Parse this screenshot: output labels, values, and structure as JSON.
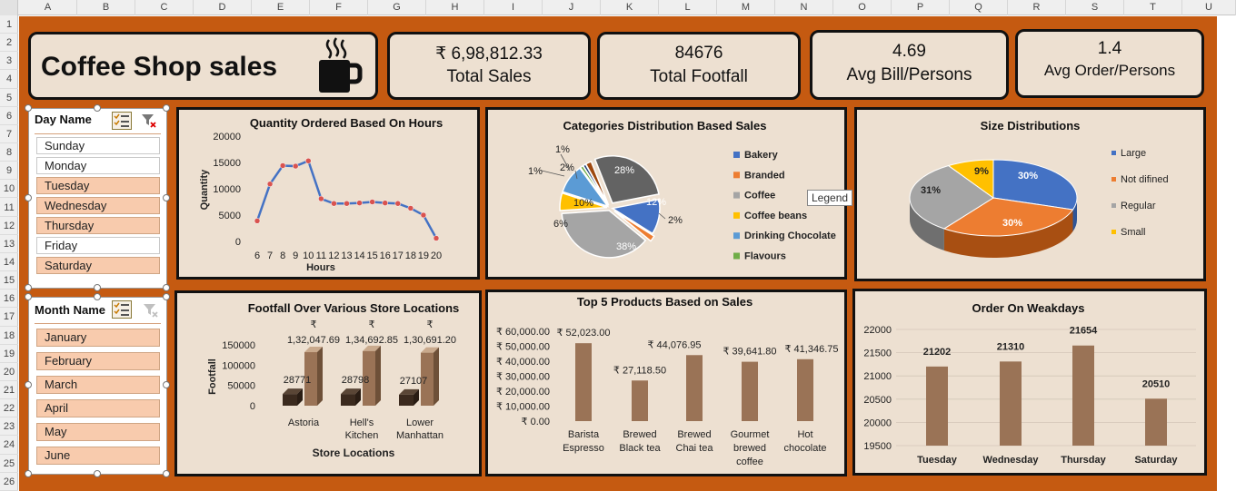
{
  "columns": [
    "A",
    "B",
    "C",
    "D",
    "E",
    "F",
    "G",
    "H",
    "I",
    "J",
    "K",
    "L",
    "M",
    "N",
    "O",
    "P",
    "Q",
    "R",
    "S",
    "T",
    "U"
  ],
  "rows": [
    "1",
    "2",
    "3",
    "4",
    "5",
    "6",
    "7",
    "8",
    "9",
    "10",
    "11",
    "12",
    "13",
    "14",
    "15",
    "16",
    "17",
    "18",
    "19",
    "20",
    "21",
    "22",
    "23",
    "24",
    "25",
    "26"
  ],
  "title": "Coffee Shop sales",
  "icons": {
    "cup": "coffee-cup-icon",
    "multiselect": "multi-select-icon",
    "clear_filter": "clear-filter-icon"
  },
  "colors": {
    "background": "#c55a11",
    "card": "#ede0d1",
    "selected": "#f8cbad",
    "bar_brown": "#9a7356",
    "line_blue": "#4472c4"
  },
  "kpis": [
    {
      "value": "₹ 6,98,812.33",
      "label": "Total Sales"
    },
    {
      "value": "84676",
      "label": "Total Footfall"
    },
    {
      "value": "4.69",
      "label": "Avg Bill/Persons"
    },
    {
      "value": "1.4",
      "label": "Avg Order/Persons"
    }
  ],
  "day_slicer": {
    "header": "Day Name",
    "items": [
      {
        "label": "Sunday",
        "selected": false
      },
      {
        "label": "Monday",
        "selected": false
      },
      {
        "label": "Tuesday",
        "selected": true
      },
      {
        "label": "Wednesday",
        "selected": true
      },
      {
        "label": "Thursday",
        "selected": true
      },
      {
        "label": "Friday",
        "selected": false
      },
      {
        "label": "Saturday",
        "selected": true
      }
    ]
  },
  "month_slicer": {
    "header": "Month Name",
    "items": [
      {
        "label": "January",
        "selected": true
      },
      {
        "label": "February",
        "selected": true
      },
      {
        "label": "March",
        "selected": true
      },
      {
        "label": "April",
        "selected": true
      },
      {
        "label": "May",
        "selected": true
      },
      {
        "label": "June",
        "selected": true
      }
    ]
  },
  "tooltip": "Legend",
  "chart_data": [
    {
      "type": "line",
      "title": "Quantity Ordered Based On Hours",
      "xlabel": "Hours",
      "ylabel": "Quantity",
      "x": [
        6,
        7,
        8,
        9,
        10,
        11,
        12,
        13,
        14,
        15,
        16,
        17,
        18,
        19,
        20
      ],
      "values": [
        3900,
        10900,
        14400,
        14300,
        15300,
        8100,
        7200,
        7200,
        7300,
        7500,
        7300,
        7200,
        6300,
        5000,
        600
      ],
      "ylim": [
        0,
        20000
      ],
      "yticks": [
        "20000",
        "15000",
        "10000",
        "5000",
        "0"
      ],
      "xticks": [
        "6",
        "7",
        "8",
        "9",
        "10",
        "11",
        "12",
        "13",
        "14",
        "15",
        "16",
        "17",
        "18",
        "19",
        "20"
      ]
    },
    {
      "type": "pie",
      "title": "Categories Distribution Based Sales",
      "legend_position": "right",
      "series": [
        {
          "name": "Bakery",
          "value": 12,
          "label": "12%",
          "color": "#4472c4"
        },
        {
          "name": "Branded",
          "value": 2,
          "label": "2%",
          "color": "#ed7d31"
        },
        {
          "name": "Coffee",
          "value": 38,
          "label": "38%",
          "color": "#a5a5a5"
        },
        {
          "name": "Coffee beans",
          "value": 6,
          "label": "6%",
          "color": "#ffc000"
        },
        {
          "name": "Drinking Chocolate",
          "value": 10,
          "label": "10%",
          "color": "#5b9bd5"
        },
        {
          "name": "Flavours",
          "value": 1,
          "label": "1%",
          "color": "#70ad47"
        },
        {
          "name": "",
          "value": 1,
          "label": "1%",
          "color": "#264478"
        },
        {
          "name": "",
          "value": 2,
          "label": "2%",
          "color": "#9e480e"
        },
        {
          "name": "",
          "value": 28,
          "label": "28%",
          "color": "#636363"
        }
      ]
    },
    {
      "type": "pie",
      "title": "Size Distributions",
      "legend_position": "right",
      "series": [
        {
          "name": "Large",
          "value": 30,
          "label": "30%",
          "color": "#4472c4"
        },
        {
          "name": "Not difined",
          "value": 30,
          "label": "30%",
          "color": "#ed7d31"
        },
        {
          "name": "Regular",
          "value": 31,
          "label": "31%",
          "color": "#a5a5a5"
        },
        {
          "name": "Small",
          "value": 9,
          "label": "9%",
          "color": "#ffc000"
        }
      ]
    },
    {
      "type": "bar",
      "title": "Footfall Over Various Store Locations",
      "xlabel": "Store Locations",
      "ylabel": "Footfall",
      "categories": [
        "Astoria",
        "Hell's Kitchen",
        "Lower Manhattan"
      ],
      "category_lines": [
        [
          "Astoria"
        ],
        [
          "Hell's",
          "Kitchen"
        ],
        [
          "Lower",
          "Manhattan"
        ]
      ],
      "series": [
        {
          "values": [
            28771,
            28798,
            27107
          ],
          "labels": [
            "28771",
            "28798",
            "27107"
          ]
        },
        {
          "values": [
            132047.69,
            134692.85,
            130691.2
          ],
          "labels": [
            "1,32,047.69",
            "1,34,692.85",
            "1,30,691.20"
          ],
          "currency": "₹"
        }
      ],
      "ylim": [
        0,
        150000
      ],
      "yticks": [
        "150000",
        "100000",
        "50000",
        "0"
      ]
    },
    {
      "type": "bar",
      "title": "Top 5 Products Based on Sales",
      "categories": [
        "Barista Espresso",
        "Brewed Black tea",
        "Brewed Chai tea",
        "Gourmet brewed coffee",
        "Hot chocolate"
      ],
      "category_lines": [
        [
          "Barista",
          "Espresso"
        ],
        [
          "Brewed",
          "Black tea"
        ],
        [
          "Brewed",
          "Chai tea"
        ],
        [
          "Gourmet",
          "brewed",
          "coffee"
        ],
        [
          "Hot",
          "chocolate"
        ]
      ],
      "values": [
        52023.0,
        27118.5,
        44076.95,
        39641.8,
        41346.75
      ],
      "value_labels": [
        "₹ 52,023.00",
        "₹ 27,118.50",
        "₹ 44,076.95",
        "₹ 39,641.80",
        "₹ 41,346.75"
      ],
      "ylim": [
        0,
        60000
      ],
      "yticks": [
        "₹ 60,000.00",
        "₹ 50,000.00",
        "₹ 40,000.00",
        "₹ 30,000.00",
        "₹ 20,000.00",
        "₹ 10,000.00",
        "₹ 0.00"
      ]
    },
    {
      "type": "bar",
      "title": "Order On Weakdays",
      "categories": [
        "Tuesday",
        "Wednesday",
        "Thursday",
        "Saturday"
      ],
      "values": [
        21202,
        21310,
        21654,
        20510
      ],
      "value_labels": [
        "21202",
        "21310",
        "21654",
        "20510"
      ],
      "ylim": [
        19500,
        22000
      ],
      "yticks": [
        "22000",
        "21500",
        "21000",
        "20500",
        "20000",
        "19500"
      ]
    }
  ]
}
